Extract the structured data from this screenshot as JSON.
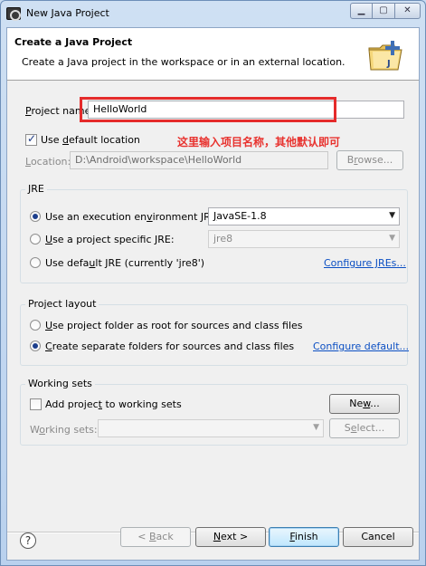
{
  "window": {
    "title": "New Java Project",
    "minimize_icon": "minimize-icon",
    "maximize_icon": "maximize-icon",
    "close_icon": "close-icon"
  },
  "banner": {
    "title": "Create a Java Project",
    "description": "Create a Java project in the workspace or in an external location."
  },
  "project": {
    "name_label_pre": "",
    "name_label_mnemonic": "P",
    "name_label_post": "roject name:",
    "name_value": "HelloWorld",
    "annotation": "这里输入项目名称，其他默认即可",
    "annotation_color": "#e8322e"
  },
  "location": {
    "default_checkbox_pre": "Use ",
    "default_checkbox_mnemonic": "d",
    "default_checkbox_post": "efault location",
    "default_checked": true,
    "label_pre": "",
    "label_mnemonic": "L",
    "label_post": "ocation:",
    "value": "D:\\Android\\workspace\\HelloWorld",
    "browse_pre": "B",
    "browse_mnemonic": "r",
    "browse_post": "owse..."
  },
  "jre": {
    "group_label": "JRE",
    "option_env_pre": "Use an execution en",
    "option_env_mnemonic": "v",
    "option_env_post": "ironment JRE:",
    "env_value_pre": "",
    "env_value_mnemonic": "J",
    "env_value_post": "avaSE-1.8",
    "option_specific_pre": "",
    "option_specific_mnemonic": "U",
    "option_specific_post": "se a project specific JRE:",
    "specific_value": "jre8",
    "option_default_pre": "Use defa",
    "option_default_mnemonic": "u",
    "option_default_post": "lt JRE (currently 'jre8')",
    "configure_link": "Configure JREs...",
    "selected": "env"
  },
  "layout": {
    "group_label": "Project layout",
    "option_root_pre": "",
    "option_root_mnemonic": "U",
    "option_root_post": "se project folder as root for sources and class files",
    "option_separate_pre": "",
    "option_separate_mnemonic": "C",
    "option_separate_post": "reate separate folders for sources and class files",
    "configure_link": "Configure default...",
    "selected": "separate"
  },
  "working_sets": {
    "group_label": "Working sets",
    "add_checkbox_pre": "Add projec",
    "add_checkbox_mnemonic": "t",
    "add_checkbox_post": " to working sets",
    "add_checked": false,
    "new_pre": "Ne",
    "new_mnemonic": "w",
    "new_post": "...",
    "label_pre": "W",
    "label_mnemonic": "o",
    "label_post": "rking sets:",
    "select_pre": "S",
    "select_mnemonic": "e",
    "select_post": "lect..."
  },
  "footer": {
    "help_icon": "help-icon",
    "help_glyph": "?",
    "back_pre": "< ",
    "back_mnemonic": "B",
    "back_post": "ack",
    "next_pre": "",
    "next_mnemonic": "N",
    "next_post": "ext >",
    "finish_pre": "",
    "finish_mnemonic": "F",
    "finish_post": "inish",
    "cancel": "Cancel"
  }
}
